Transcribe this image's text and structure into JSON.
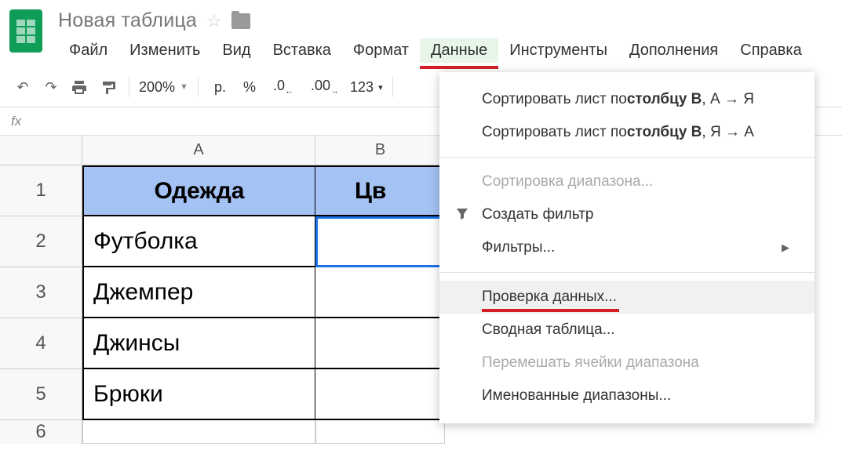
{
  "app": {
    "title": "Новая таблица"
  },
  "menubar": [
    "Файл",
    "Изменить",
    "Вид",
    "Вставка",
    "Формат",
    "Данные",
    "Инструменты",
    "Дополнения",
    "Справка"
  ],
  "menubar_active_index": 5,
  "toolbar": {
    "zoom": "200%",
    "currency": "р.",
    "percent": "%",
    "dec_decrease": ".0",
    "dec_increase": ".00",
    "format_menu": "123"
  },
  "formula_bar": {
    "fx": "fx"
  },
  "columns": [
    "A",
    "B"
  ],
  "rows": [
    "1",
    "2",
    "3",
    "4",
    "5",
    "6"
  ],
  "table": {
    "header": {
      "A": "Одежда",
      "B": "Цв"
    },
    "data": [
      {
        "A": "Футболка",
        "B": ""
      },
      {
        "A": "Джемпер",
        "B": ""
      },
      {
        "A": "Джинсы",
        "B": ""
      },
      {
        "A": "Брюки",
        "B": ""
      }
    ]
  },
  "dropdown": {
    "sort_asc_prefix": "Сортировать лист по ",
    "sort_asc_bold": "столбцу B",
    "sort_asc_suffix": ", А → Я",
    "sort_desc_prefix": "Сортировать лист по ",
    "sort_desc_bold": "столбцу B",
    "sort_desc_suffix": ", Я → А",
    "sort_range": "Сортировка диапазона...",
    "create_filter": "Создать фильтр",
    "filters": "Фильтры...",
    "data_validation": "Проверка данных...",
    "pivot_table": "Сводная таблица...",
    "shuffle": "Перемешать ячейки диапазона",
    "named_ranges": "Именованные диапазоны..."
  }
}
